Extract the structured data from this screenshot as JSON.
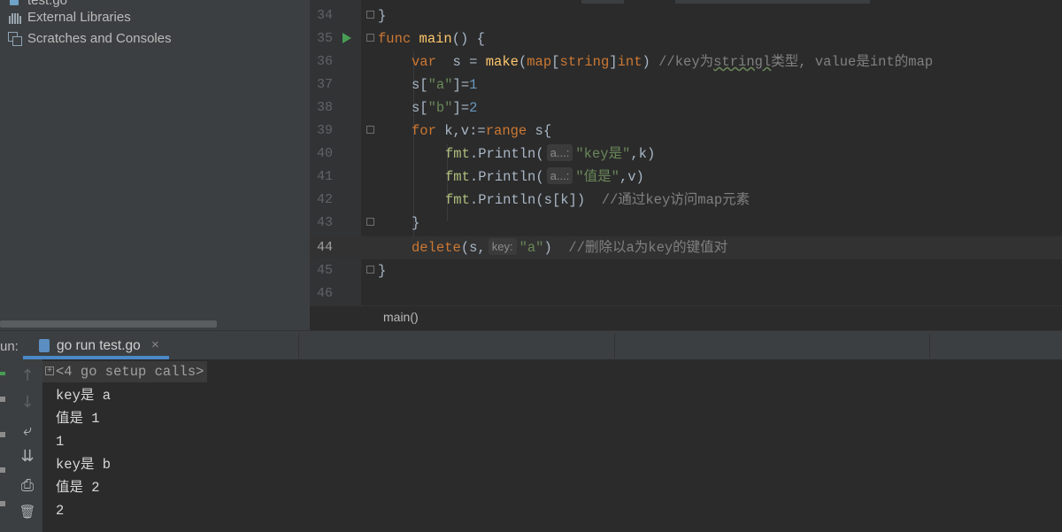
{
  "project_tree": {
    "items": [
      {
        "label": "test.go"
      },
      {
        "label": "External Libraries"
      },
      {
        "label": "Scratches and Consoles"
      }
    ]
  },
  "editor": {
    "line_numbers": [
      "34",
      "35",
      "36",
      "37",
      "38",
      "39",
      "40",
      "41",
      "42",
      "43",
      "44",
      "45",
      "46"
    ],
    "active_line": "44",
    "breadcrumb": "main()",
    "lines": {
      "l34": {
        "brace": "}"
      },
      "l35": {
        "kw": "func",
        "name": "main",
        "rest": "() {"
      },
      "l36": {
        "kw": "var",
        "a": "  s = ",
        "fn": "make",
        "b": "(",
        "map": "map",
        "c": "[",
        "string": "string",
        "d": "]",
        "int": "int",
        "e": ") ",
        "comment": "//key为",
        "comment_u": "stringl",
        "comment2": "类型, value是int的map"
      },
      "l37": {
        "a": "s[",
        "str": "\"a\"",
        "b": "]=",
        "num": "1"
      },
      "l38": {
        "a": "s[",
        "str": "\"b\"",
        "b": "]=",
        "num": "2"
      },
      "l39": {
        "kw": "for",
        "a": " k,v:=",
        "range": "range",
        "b": " s{"
      },
      "l40": {
        "pkg": "fmt",
        "a": ".",
        "fn": "Println",
        "b": "(",
        "hint": "a...:",
        "str": "\"key是\"",
        "c": ",k)"
      },
      "l41": {
        "pkg": "fmt",
        "a": ".",
        "fn": "Println",
        "b": "(",
        "hint": "a...:",
        "str": "\"值是\"",
        "c": ",v)"
      },
      "l42": {
        "pkg": "fmt",
        "a": ".",
        "fn": "Println",
        "b": "(s[k])  ",
        "comment": "//通过key访问map元素"
      },
      "l43": {
        "brace": "}"
      },
      "l44": {
        "fn": "delete",
        "a": "(s,",
        "hint": "key:",
        "str": "\"a\"",
        "b": ")  ",
        "comment": "//删除以a为key的键值对"
      },
      "l45": {
        "brace": "}"
      }
    }
  },
  "run_window": {
    "label": "un:",
    "tab": {
      "label": "go run test.go",
      "close": "×"
    },
    "setup_calls": "<4 go setup calls>",
    "output": [
      "key是 a",
      "值是 1",
      "1",
      "key是 b",
      "值是 2",
      "2"
    ],
    "toolbar": {
      "up": "↑",
      "down": "↓",
      "wrap": "⤶",
      "scroll_end": "⇊",
      "print": "⎙",
      "trash": "🗑"
    }
  },
  "colors": {
    "keyword": "#cc7832",
    "function": "#ffc66d",
    "string": "#6a8759",
    "number": "#6897bb",
    "comment": "#808080",
    "run_green": "#499c54",
    "tab_underline": "#4a88c7"
  },
  "icons": [
    "library-icon",
    "scratch-icon",
    "run-gutter-icon",
    "go-file-icon",
    "close-icon",
    "arrow-up-icon",
    "arrow-down-icon",
    "soft-wrap-icon",
    "scroll-to-end-icon",
    "print-icon",
    "trash-icon",
    "fold-icon"
  ]
}
